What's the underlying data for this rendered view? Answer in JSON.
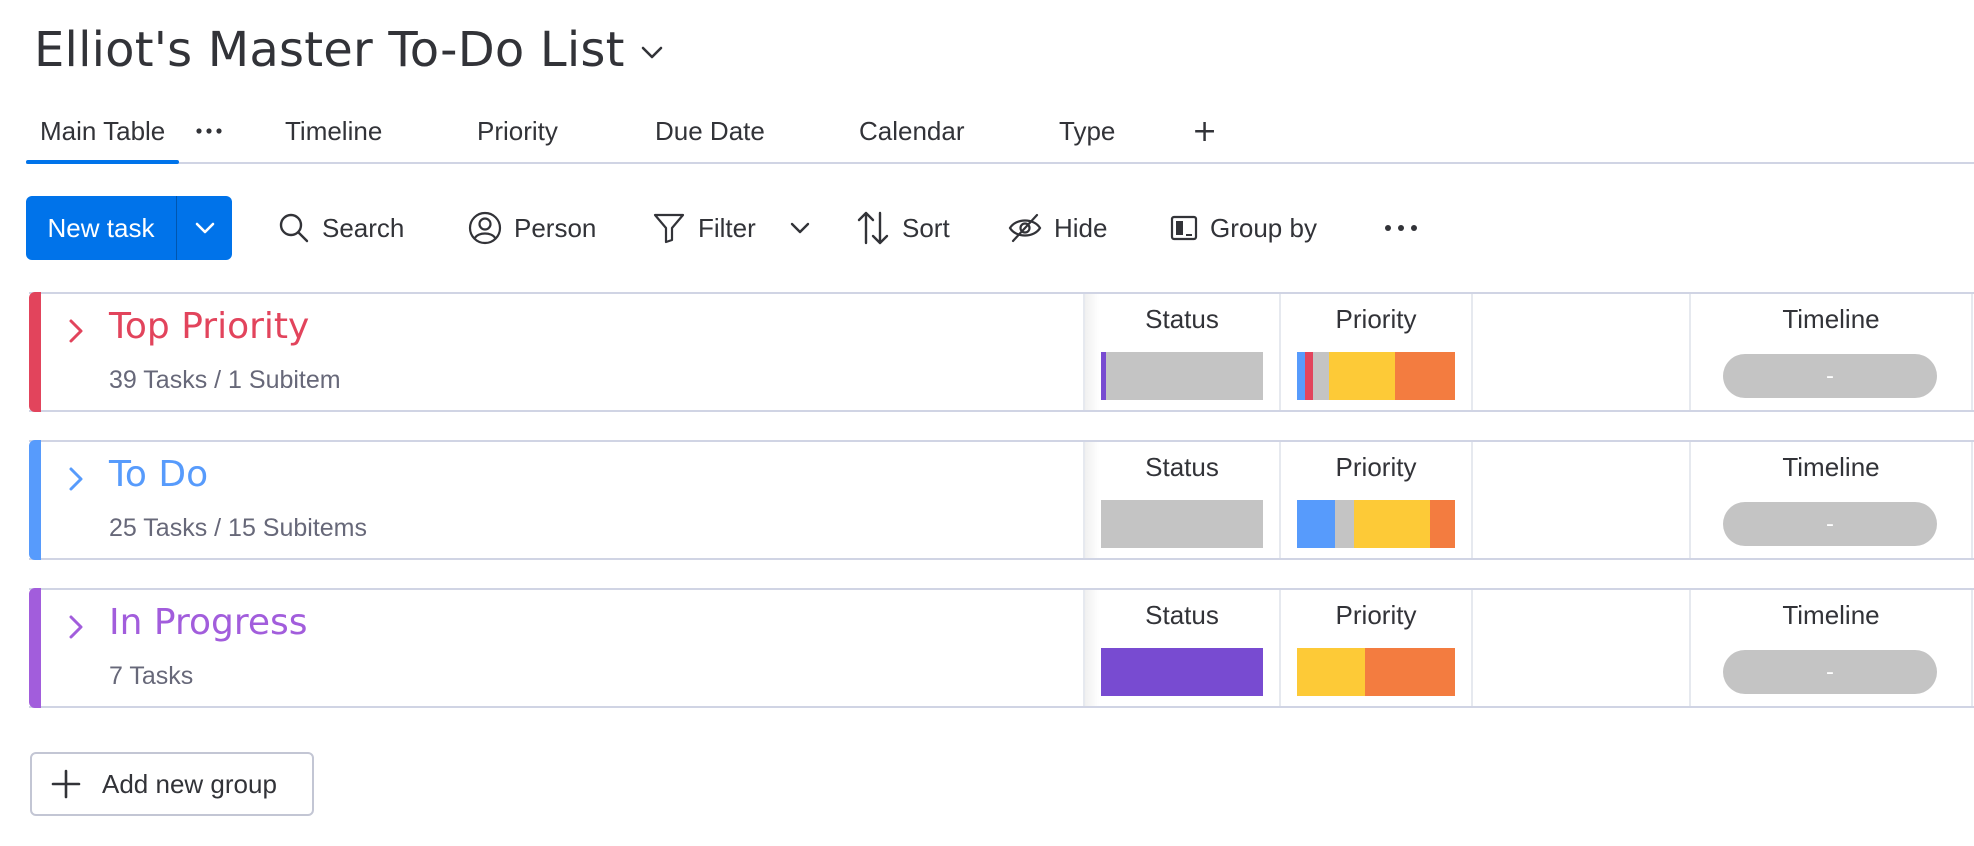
{
  "board": {
    "title": "Elliot's Master To-Do List"
  },
  "tabs": [
    {
      "label": "Main Table",
      "active": true
    },
    {
      "label": "Timeline"
    },
    {
      "label": "Priority"
    },
    {
      "label": "Due Date"
    },
    {
      "label": "Calendar"
    },
    {
      "label": "Type"
    }
  ],
  "tab_add_label": "+",
  "toolbar": {
    "new_task_label": "New task",
    "search_label": "Search",
    "person_label": "Person",
    "filter_label": "Filter",
    "sort_label": "Sort",
    "hide_label": "Hide",
    "group_by_label": "Group by"
  },
  "columns": {
    "status": "Status",
    "priority": "Priority",
    "timeline": "Timeline"
  },
  "groups": [
    {
      "name": "Top Priority",
      "count": "39 Tasks / 1 Subitem",
      "color": "#e2445c",
      "status_segments": [
        {
          "color": "#784bd1",
          "pct": 3
        },
        {
          "color": "#c4c4c4",
          "pct": 97
        }
      ],
      "priority_segments": [
        {
          "color": "#579bfc",
          "pct": 5
        },
        {
          "color": "#e2445c",
          "pct": 5
        },
        {
          "color": "#c4c4c4",
          "pct": 10
        },
        {
          "color": "#fdca37",
          "pct": 42
        },
        {
          "color": "#f37c40",
          "pct": 38
        }
      ],
      "timeline": "-"
    },
    {
      "name": "To Do",
      "count": "25 Tasks / 15 Subitems",
      "color": "#579bfc",
      "status_segments": [
        {
          "color": "#c4c4c4",
          "pct": 100
        }
      ],
      "priority_segments": [
        {
          "color": "#579bfc",
          "pct": 24
        },
        {
          "color": "#c4c4c4",
          "pct": 12
        },
        {
          "color": "#fdca37",
          "pct": 48
        },
        {
          "color": "#f37c40",
          "pct": 16
        }
      ],
      "timeline": "-"
    },
    {
      "name": "In Progress",
      "count": "7 Tasks",
      "color": "#a25ddc",
      "status_segments": [
        {
          "color": "#784bd1",
          "pct": 100
        }
      ],
      "priority_segments": [
        {
          "color": "#fdca37",
          "pct": 43
        },
        {
          "color": "#f37c40",
          "pct": 57
        }
      ],
      "timeline": "-"
    }
  ],
  "add_group_label": "Add new group"
}
